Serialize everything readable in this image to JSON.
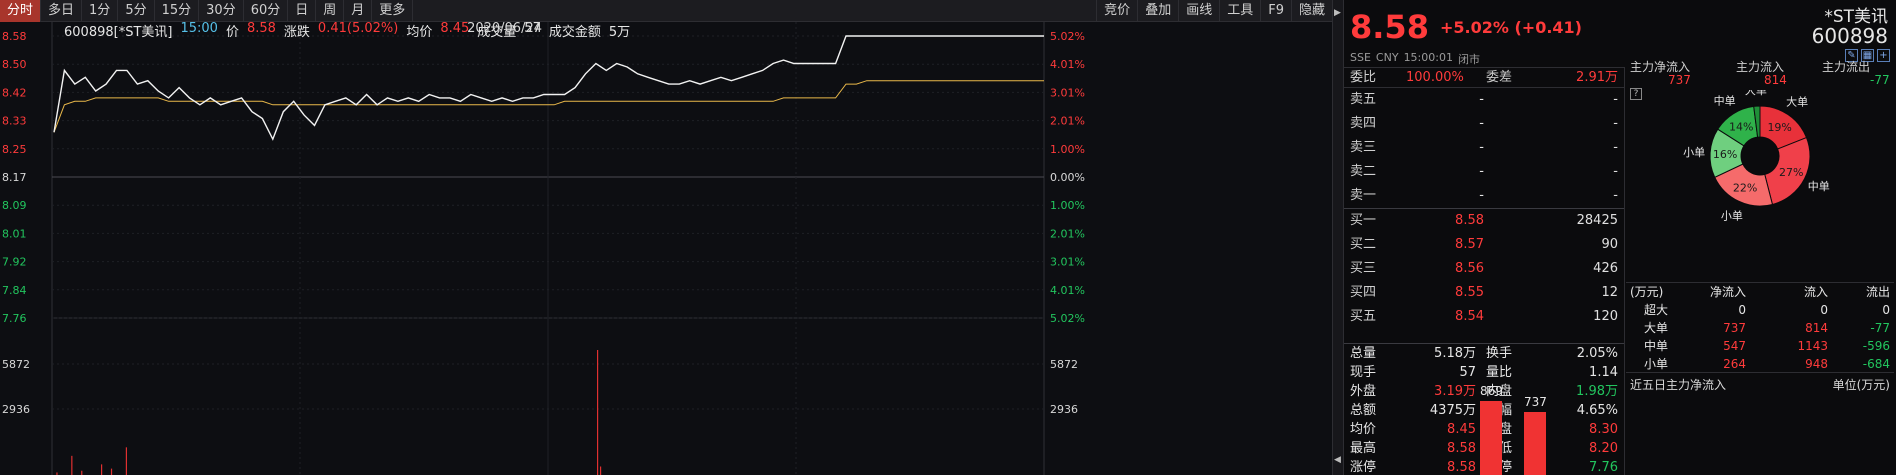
{
  "toolbar": {
    "left": [
      "分时",
      "多日",
      "1分",
      "5分",
      "15分",
      "30分",
      "60分",
      "日",
      "周",
      "月",
      "更多"
    ],
    "right": [
      "竞价",
      "叠加",
      "画线",
      "工具",
      "F9",
      "隐藏"
    ]
  },
  "info": {
    "code": "600898[*ST美讯]",
    "time": "15:00",
    "price_label": "价",
    "price": "8.58",
    "change_label": "涨跌",
    "change": "0.41(5.02%)",
    "avg_label": "均价",
    "avg": "8.45",
    "vol_label": "成交量",
    "vol": "57",
    "amount_label": "成交金额",
    "amount": "5万",
    "date": "2020/06/24"
  },
  "chart_data": {
    "type": "line",
    "series": [],
    "left_ticks": [
      "8.58",
      "8.50",
      "8.42",
      "8.33",
      "8.25",
      "8.17",
      "8.09",
      "8.01",
      "7.92",
      "7.84",
      "7.76"
    ],
    "right_ticks": [
      "5.02%",
      "4.01%",
      "3.01%",
      "2.01%",
      "1.00%",
      "0.00%",
      "1.00%",
      "2.01%",
      "3.01%",
      "4.01%",
      "5.02%"
    ],
    "vol_ticks_left": [
      "5872",
      "2936"
    ],
    "vol_ticks_right": [
      "5872",
      "2936"
    ],
    "ylim": [
      7.76,
      8.58
    ],
    "prev_close": 8.17,
    "price_path": [
      8.3,
      8.48,
      8.44,
      8.46,
      8.42,
      8.44,
      8.48,
      8.48,
      8.44,
      8.45,
      8.42,
      8.4,
      8.43,
      8.4,
      8.38,
      8.4,
      8.38,
      8.39,
      8.4,
      8.36,
      8.34,
      8.28,
      8.36,
      8.39,
      8.35,
      8.32,
      8.38,
      8.39,
      8.4,
      8.38,
      8.41,
      8.38,
      8.4,
      8.39,
      8.4,
      8.39,
      8.41,
      8.4,
      8.4,
      8.39,
      8.41,
      8.4,
      8.39,
      8.4,
      8.39,
      8.4,
      8.4,
      8.41,
      8.41,
      8.41,
      8.43,
      8.47,
      8.5,
      8.48,
      8.5,
      8.49,
      8.47,
      8.46,
      8.45,
      8.44,
      8.44,
      8.45,
      8.44,
      8.45,
      8.46,
      8.45,
      8.46,
      8.47,
      8.48,
      8.5,
      8.51,
      8.5,
      8.5,
      8.5,
      8.5,
      8.5,
      8.58,
      8.58,
      8.58,
      8.58,
      8.58,
      8.58,
      8.58,
      8.58,
      8.58,
      8.58,
      8.58,
      8.58,
      8.58,
      8.58,
      8.58,
      8.58,
      8.58,
      8.58,
      8.58,
      8.58
    ],
    "avg_path": [
      8.3,
      8.38,
      8.39,
      8.39,
      8.4,
      8.4,
      8.4,
      8.4,
      8.4,
      8.4,
      8.4,
      8.39,
      8.39,
      8.39,
      8.39,
      8.39,
      8.39,
      8.39,
      8.39,
      8.39,
      8.39,
      8.38,
      8.38,
      8.38,
      8.38,
      8.38,
      8.38,
      8.38,
      8.38,
      8.38,
      8.38,
      8.38,
      8.38,
      8.38,
      8.38,
      8.38,
      8.38,
      8.38,
      8.38,
      8.38,
      8.38,
      8.38,
      8.38,
      8.38,
      8.38,
      8.38,
      8.38,
      8.38,
      8.38,
      8.39,
      8.39,
      8.39,
      8.39,
      8.39,
      8.39,
      8.39,
      8.39,
      8.39,
      8.39,
      8.39,
      8.39,
      8.39,
      8.39,
      8.39,
      8.39,
      8.39,
      8.39,
      8.39,
      8.39,
      8.39,
      8.4,
      8.4,
      8.4,
      8.4,
      8.4,
      8.4,
      8.44,
      8.44,
      8.45,
      8.45,
      8.45,
      8.45,
      8.45,
      8.45,
      8.45,
      8.45,
      8.45,
      8.45,
      8.45,
      8.45,
      8.45,
      8.45,
      8.45,
      8.45,
      8.45,
      8.45
    ],
    "volume_max": 5872,
    "volume_bars": [
      [
        0.005,
        120
      ],
      [
        0.02,
        900
      ],
      [
        0.03,
        200
      ],
      [
        0.05,
        500
      ],
      [
        0.06,
        300
      ],
      [
        0.075,
        1300
      ],
      [
        0.55,
        5872
      ],
      [
        0.553,
        400
      ]
    ]
  },
  "panel": {
    "price": "8.58",
    "change": "+5.02% (+0.41)",
    "name": "*ST美讯",
    "code": "600898",
    "status": [
      "SSE",
      "CNY",
      "15:00:01",
      "闭市"
    ],
    "icons": [
      "edit-icon",
      "grid-icon",
      "plus-icon"
    ],
    "weibi_label": "委比",
    "weibi": "100.00%",
    "weicha_label": "委差",
    "weicha": "2.91万",
    "sells": [
      {
        "label": "卖五",
        "price": "-",
        "vol": "-"
      },
      {
        "label": "卖四",
        "price": "-",
        "vol": "-"
      },
      {
        "label": "卖三",
        "price": "-",
        "vol": "-"
      },
      {
        "label": "卖二",
        "price": "-",
        "vol": "-"
      },
      {
        "label": "卖一",
        "price": "-",
        "vol": "-"
      }
    ],
    "buys": [
      {
        "label": "买一",
        "price": "8.58",
        "vol": "28425"
      },
      {
        "label": "买二",
        "price": "8.57",
        "vol": "90"
      },
      {
        "label": "买三",
        "price": "8.56",
        "vol": "426"
      },
      {
        "label": "买四",
        "price": "8.55",
        "vol": "12"
      },
      {
        "label": "买五",
        "price": "8.54",
        "vol": "120"
      }
    ],
    "stats": [
      {
        "l1": "总量",
        "v1": "5.18万",
        "l2": "换手",
        "v2": "2.05%",
        "c1": "white",
        "c2": "white"
      },
      {
        "l1": "现手",
        "v1": "57",
        "l2": "量比",
        "v2": "1.14",
        "c1": "white",
        "c2": "white"
      },
      {
        "l1": "外盘",
        "v1": "3.19万",
        "l2": "内盘",
        "v2": "1.98万",
        "c1": "red",
        "c2": "green"
      },
      {
        "l1": "总额",
        "v1": "4375万",
        "l2": "振幅",
        "v2": "4.65%",
        "c1": "white",
        "c2": "white"
      },
      {
        "l1": "均价",
        "v1": "8.45",
        "l2": "开盘",
        "v2": "8.30",
        "c1": "red",
        "c2": "red"
      },
      {
        "l1": "最高",
        "v1": "8.58",
        "l2": "最低",
        "v2": "8.20",
        "c1": "red",
        "c2": "red"
      },
      {
        "l1": "涨停",
        "v1": "8.58",
        "l2": "跌停",
        "v2": "7.76",
        "c1": "red",
        "c2": "green"
      }
    ],
    "flow": {
      "net_label": "主力净流入",
      "net": "737",
      "in_label": "主力流入",
      "in": "814",
      "out_label": "主力流出",
      "out": "-77"
    },
    "pie": {
      "slices": [
        {
          "name": "大单",
          "pct": 19,
          "color": "#e8313a",
          "label": "19%"
        },
        {
          "name": "中单",
          "pct": 27,
          "color": "#f0404a",
          "label": "27%"
        },
        {
          "name": "小单",
          "pct": 22,
          "color": "#f56b6b",
          "label": "22%"
        },
        {
          "name": "小单",
          "pct": 16,
          "color": "#6fcf7f",
          "label": "16%"
        },
        {
          "name": "中单",
          "pct": 14,
          "color": "#2fb24a",
          "label": "14%"
        },
        {
          "name": "大单",
          "pct": 2,
          "color": "#1f8f38",
          "label": ""
        }
      ]
    },
    "flow_table": {
      "headers": [
        "(万元)",
        "净流入",
        "流入",
        "流出"
      ],
      "rows": [
        {
          "name": "超大",
          "net": "0",
          "in": "0",
          "out": "0",
          "nc": "white",
          "ic": "white",
          "oc": "white"
        },
        {
          "name": "大单",
          "net": "737",
          "in": "814",
          "out": "-77",
          "nc": "red",
          "ic": "red",
          "oc": "green"
        },
        {
          "name": "中单",
          "net": "547",
          "in": "1143",
          "out": "-596",
          "nc": "red",
          "ic": "red",
          "oc": "green"
        },
        {
          "name": "小单",
          "net": "264",
          "in": "948",
          "out": "-684",
          "nc": "red",
          "ic": "red",
          "oc": "green"
        }
      ]
    },
    "five_day": {
      "title": "近五日主力净流入",
      "unit": "单位(万元)",
      "bars": [
        {
          "value": 869,
          "label": "869"
        },
        {
          "value": 737,
          "label": "737"
        }
      ]
    }
  }
}
